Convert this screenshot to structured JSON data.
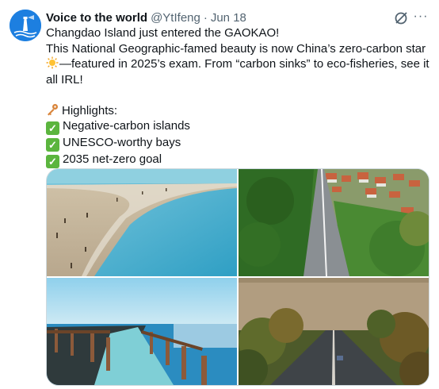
{
  "tweet": {
    "author_name": "Voice to the world",
    "handle": "@YtIfeng",
    "separator": "·",
    "date": "Jun 18",
    "more_label": "···",
    "lines": [
      "Changdao Island just entered the GAOKAO!",
      "This National Geographic-famed beauty is now China’s zero-carbon star",
      "—featured in 2025’s exam. From “carbon sinks” to eco-fisheries, see it",
      "all IRL!"
    ],
    "highlights_title": "Highlights:",
    "highlights": [
      "Negative-carbon islands",
      "UNESCO-worthy bays",
      "2035 net-zero goal"
    ],
    "check_glyph": "✓",
    "icons": {
      "avatar": "lighthouse-logo-icon",
      "grok": "grok-icon",
      "more": "more-icon",
      "star": "sun-emoji-icon",
      "key": "key-emoji-icon",
      "check": "check-box-emoji-icon"
    }
  },
  "colors": {
    "text": "#0f1419",
    "secondary": "#536471",
    "avatar": "#1d7fe0",
    "check": "#5bb53e",
    "border": "#cfd9de"
  }
}
